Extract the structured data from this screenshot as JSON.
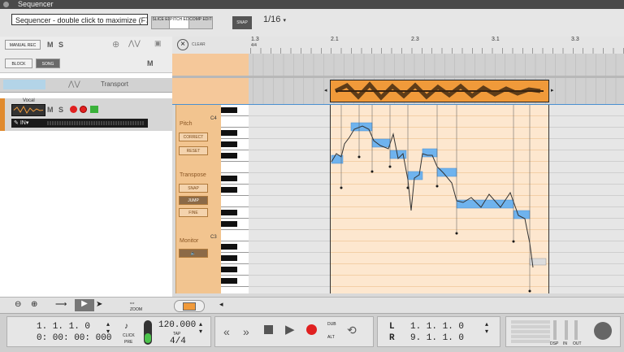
{
  "window": {
    "title": "Sequencer"
  },
  "tooltip": {
    "text": "Sequencer - double click to maximize (F7)"
  },
  "top_buttons": {
    "slice": "SLICE EDIT",
    "pitch": "PITCH EDIT",
    "comp": "COMP EDIT",
    "snap": "SNAP",
    "quantize": "1/16"
  },
  "left": {
    "mode_btn": "MANUAL REC",
    "m": "M",
    "s": "S",
    "block": "BLOCK",
    "song": "SONG",
    "m2": "M",
    "transport_label": "Transport",
    "vocal_name": "Vocal",
    "input_label": "IN"
  },
  "lane_controls": {
    "pitch_label": "Pitch",
    "correct": "CORRECT",
    "reset": "RESET",
    "transpose_label": "Transpose",
    "snap": "SNAP",
    "jump": "JUMP",
    "fine": "FINE",
    "monitor_label": "Monitor",
    "clear": "CLEAR"
  },
  "piano": {
    "c4": "C4",
    "c3": "C3"
  },
  "ruler": {
    "ticks": [
      {
        "label": "1.3",
        "sub": "4/4"
      },
      {
        "label": "2.1",
        "sub": ""
      },
      {
        "label": "2.3",
        "sub": ""
      },
      {
        "label": "3.1",
        "sub": ""
      },
      {
        "label": "3.3",
        "sub": ""
      }
    ]
  },
  "bottom_toolbar": {
    "zoom_label": "ZOOM"
  },
  "transport": {
    "pos_bars": "1.  1.  1.    0",
    "pos_time": "0: 00: 00: 000",
    "click_label": "CLICK",
    "pre_label": "PRE",
    "tempo": "120.000",
    "tap_label": "TAP",
    "signature": "4/4",
    "dub_label": "DUB",
    "alt_label": "ALT",
    "loop_l_label": "L",
    "loop_r_label": "R",
    "loop_l": "1.  1.  1.    0",
    "loop_r": "9.  1.  1.    0",
    "dsp_label": "DSP",
    "in_label": "IN",
    "out_label": "OUT"
  },
  "colors": {
    "accent_orange": "#f09a3a",
    "note_blue": "#6fb3ee",
    "record_red": "#e02020"
  }
}
